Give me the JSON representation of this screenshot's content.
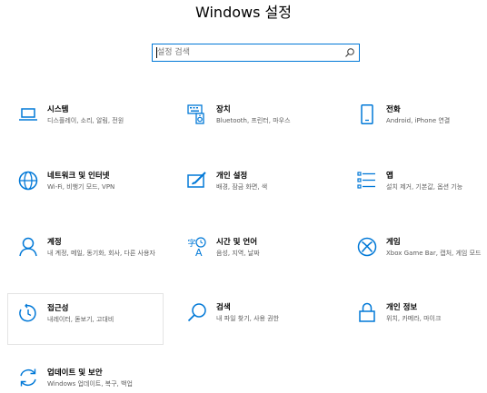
{
  "title": "Windows 설정",
  "search": {
    "placeholder": "설정 검색",
    "icon": "search-icon"
  },
  "tiles": [
    {
      "name": "시스템",
      "desc": "디스플레이, 소리, 알림, 전원",
      "icon": "laptop-icon"
    },
    {
      "name": "장치",
      "desc": "Bluetooth, 프린터, 마우스",
      "icon": "keyboard-speaker-icon"
    },
    {
      "name": "전화",
      "desc": "Android, iPhone 연결",
      "icon": "phone-icon"
    },
    {
      "name": "네트워크 및 인터넷",
      "desc": "Wi-Fi, 비행기 모드, VPN",
      "icon": "globe-icon"
    },
    {
      "name": "개인 설정",
      "desc": "배경, 잠금 화면, 색",
      "icon": "personalization-icon"
    },
    {
      "name": "앱",
      "desc": "설치 제거, 기본값, 옵션 기능",
      "icon": "apps-list-icon"
    },
    {
      "name": "계정",
      "desc": "내 계정, 메일, 동기화, 회사, 다른 사용자",
      "icon": "person-icon"
    },
    {
      "name": "시간 및 언어",
      "desc": "음성, 지역, 날짜",
      "icon": "time-language-icon"
    },
    {
      "name": "게임",
      "desc": "Xbox Game Bar, 캡처, 게임 모드",
      "icon": "xbox-icon"
    },
    {
      "name": "접근성",
      "desc": "내레이터, 돋보기, 고대비",
      "icon": "ease-of-access-icon"
    },
    {
      "name": "검색",
      "desc": "내 파일 찾기, 사용 권한",
      "icon": "search-icon"
    },
    {
      "name": "개인 정보",
      "desc": "위치, 카메라, 마이크",
      "icon": "lock-icon"
    },
    {
      "name": "업데이트 및 보안",
      "desc": "Windows 업데이트, 복구, 백업",
      "icon": "update-sync-icon"
    }
  ],
  "colors": {
    "accent": "#0078d7",
    "text": "#000000",
    "desc": "#5c5c5c"
  }
}
